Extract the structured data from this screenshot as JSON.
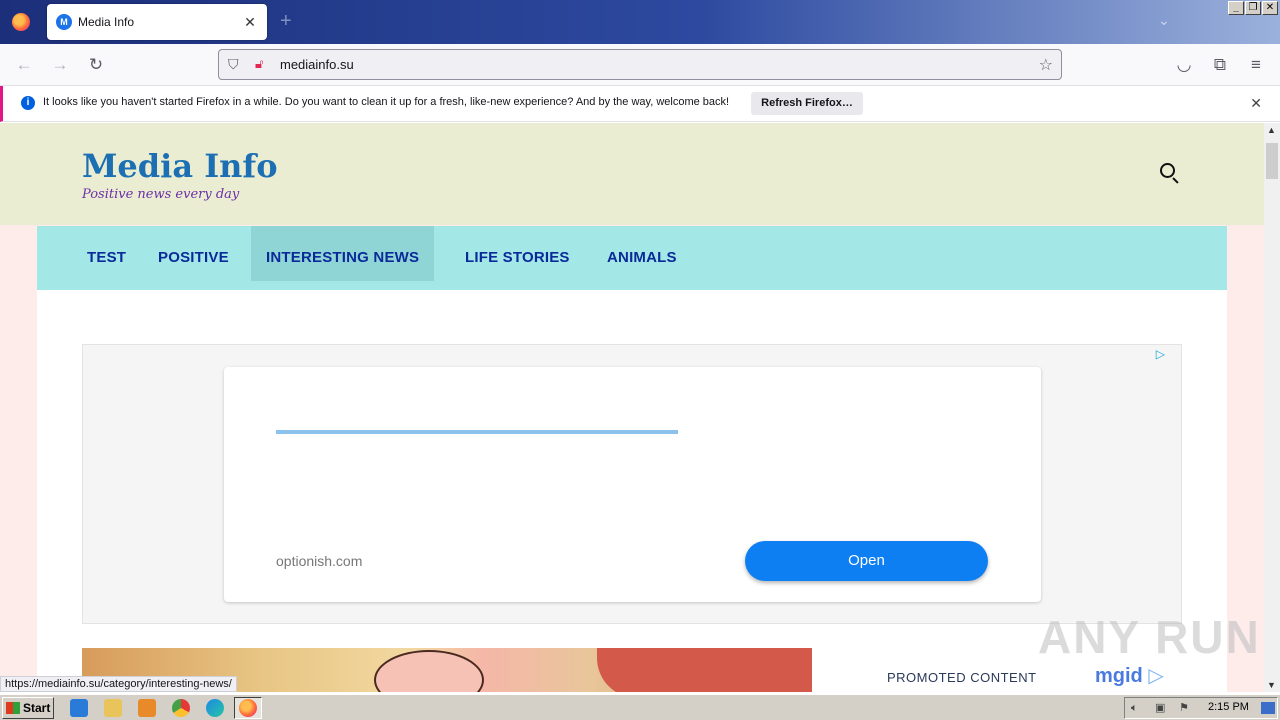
{
  "browser": {
    "tab_title": "Media Info",
    "tab_favicon_letter": "M",
    "tab_close": "✕",
    "new_tab": "+",
    "url": "mediainfo.su",
    "window_buttons": [
      "_",
      "❐",
      "✕"
    ]
  },
  "notification": {
    "message": "It looks like you haven't started Firefox in a while. Do you want to clean it up for a fresh, like-new experience? And by the way, welcome back!",
    "button_label": "Refresh Firefox…",
    "close": "✕"
  },
  "site": {
    "title": "Media Info",
    "tagline": "Positive news every day",
    "menu": [
      {
        "label": "TEST"
      },
      {
        "label": "POSITIVE"
      },
      {
        "label": "INTERESTING NEWS"
      },
      {
        "label": "LIFE STORIES"
      },
      {
        "label": "ANIMALS"
      }
    ]
  },
  "ad": {
    "domain": "optionish.com",
    "button": "Open"
  },
  "promoted": {
    "label": "PROMOTED CONTENT",
    "brand": "mgid"
  },
  "status_link": "https://mediainfo.su/category/interesting-news/",
  "watermark": "ANY RUN",
  "taskbar": {
    "start": "Start",
    "clock": "2:15 PM"
  },
  "colors": {
    "site_title": "#1b6fb2",
    "tagline": "#6b2fa8",
    "menu_bg": "#a3e7e6",
    "menu_text": "#0b2a9a",
    "header_bg": "#ebedd3",
    "ad_button": "#0d7ff2"
  }
}
